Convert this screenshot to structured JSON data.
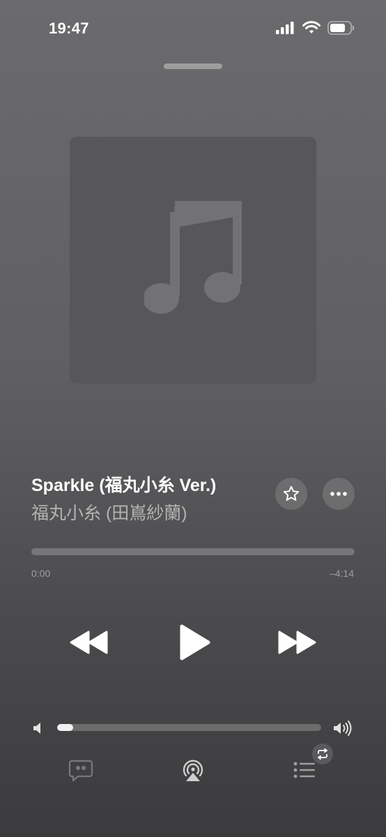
{
  "status_bar": {
    "time": "19:47",
    "signal_icon": "cellular-signal-icon",
    "wifi_icon": "wifi-icon",
    "battery_icon": "battery-icon"
  },
  "artwork": {
    "icon": "music-note-icon",
    "background": "#575759"
  },
  "track": {
    "title": "Sparkle (福丸小糸 Ver.)",
    "artist": "福丸小糸 (田嶌紗蘭)"
  },
  "actions": {
    "favorite_icon": "star-icon",
    "more_icon": "ellipsis-icon"
  },
  "progress": {
    "elapsed": "0:00",
    "remaining": "–4:14",
    "fraction": 0
  },
  "transport": {
    "rewind_icon": "rewind-icon",
    "play_icon": "play-icon",
    "forward_icon": "fast-forward-icon"
  },
  "volume": {
    "level": 0.06,
    "low_icon": "speaker-low-icon",
    "high_icon": "speaker-high-icon"
  },
  "bottom_bar": {
    "lyrics_icon": "lyrics-icon",
    "airplay_icon": "airplay-icon",
    "queue_icon": "queue-list-icon",
    "repeat_icon": "repeat-icon"
  }
}
